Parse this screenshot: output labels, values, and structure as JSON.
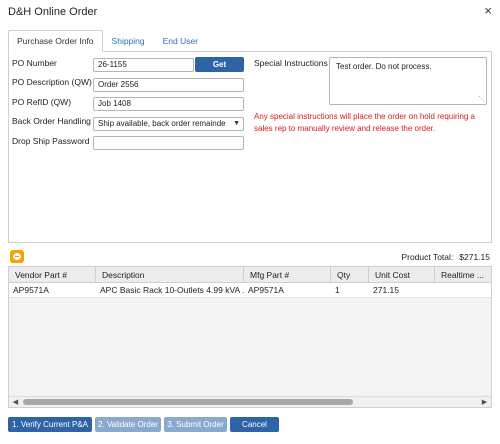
{
  "window": {
    "title": "D&H Online Order",
    "close_glyph": "×"
  },
  "tabs": [
    {
      "label": "Purchase Order Info",
      "active": true
    },
    {
      "label": "Shipping",
      "active": false
    },
    {
      "label": "End User",
      "active": false
    }
  ],
  "form": {
    "po_number": {
      "label": "PO Number",
      "value": "26-1155",
      "button": "Get"
    },
    "po_description": {
      "label": "PO Description (QW)",
      "value": "Order 2556"
    },
    "po_refid": {
      "label": "PO RefID (QW)",
      "value": "Job 1408"
    },
    "back_order": {
      "label": "Back Order Handling",
      "value": "Ship available, back order remainde"
    },
    "drop_ship_password": {
      "label": "Drop Ship Password",
      "value": ""
    },
    "special_instructions": {
      "label": "Special Instructions",
      "value": "Test order. Do not process.",
      "warning": "Any special instructions will place the order on hold requiring a sales rep to manually review and release the order."
    }
  },
  "summary": {
    "product_total_label": "Product Total:",
    "product_total_value": "$271.15"
  },
  "grid": {
    "columns": [
      "Vendor Part #",
      "Description",
      "Mfg Part #",
      "Qty",
      "Unit Cost",
      "Realtime ..."
    ],
    "rows": [
      [
        "AP9571A",
        "APC Basic Rack 10-Outlets 4.99 kVA ...",
        "AP9571A",
        "1",
        "271.15",
        ""
      ]
    ]
  },
  "scrollbar": {
    "left_glyph": "◀",
    "right_glyph": "▶"
  },
  "actions": {
    "verify": "1. Verify Current P&A",
    "validate": "2. Validate Order",
    "submit": "3. Submit Order",
    "cancel": "Cancel"
  },
  "colors": {
    "primary_button": "#2e63a6",
    "disabled_button": "#8aa9cf",
    "warning_text": "#d42020",
    "link_tab": "#2f6eb8",
    "collapse_icon": "#f4a300"
  }
}
